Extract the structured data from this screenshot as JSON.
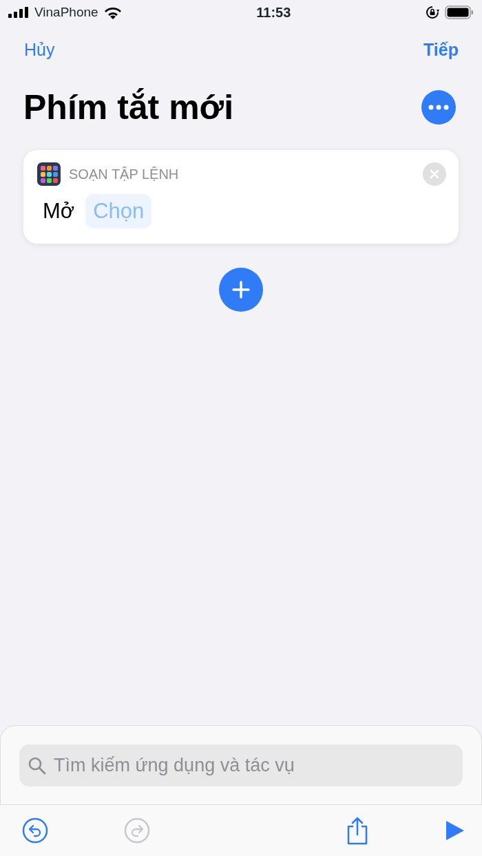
{
  "status_bar": {
    "carrier": "VinaPhone",
    "time": "11:53"
  },
  "nav": {
    "cancel": "Hủy",
    "next": "Tiếp"
  },
  "title": "Phím tắt mới",
  "actions": [
    {
      "app": "SOẠN TẬP LỆNH",
      "verb": "Mở",
      "parameter": "Chọn"
    }
  ],
  "search": {
    "placeholder": "Tìm kiếm ứng dụng và tác vụ"
  },
  "toolbar": [
    {
      "kind": "undo",
      "disabled": false
    },
    {
      "kind": "redo",
      "disabled": true
    },
    {
      "kind": "share",
      "disabled": false
    },
    {
      "kind": "play",
      "disabled": false
    }
  ]
}
